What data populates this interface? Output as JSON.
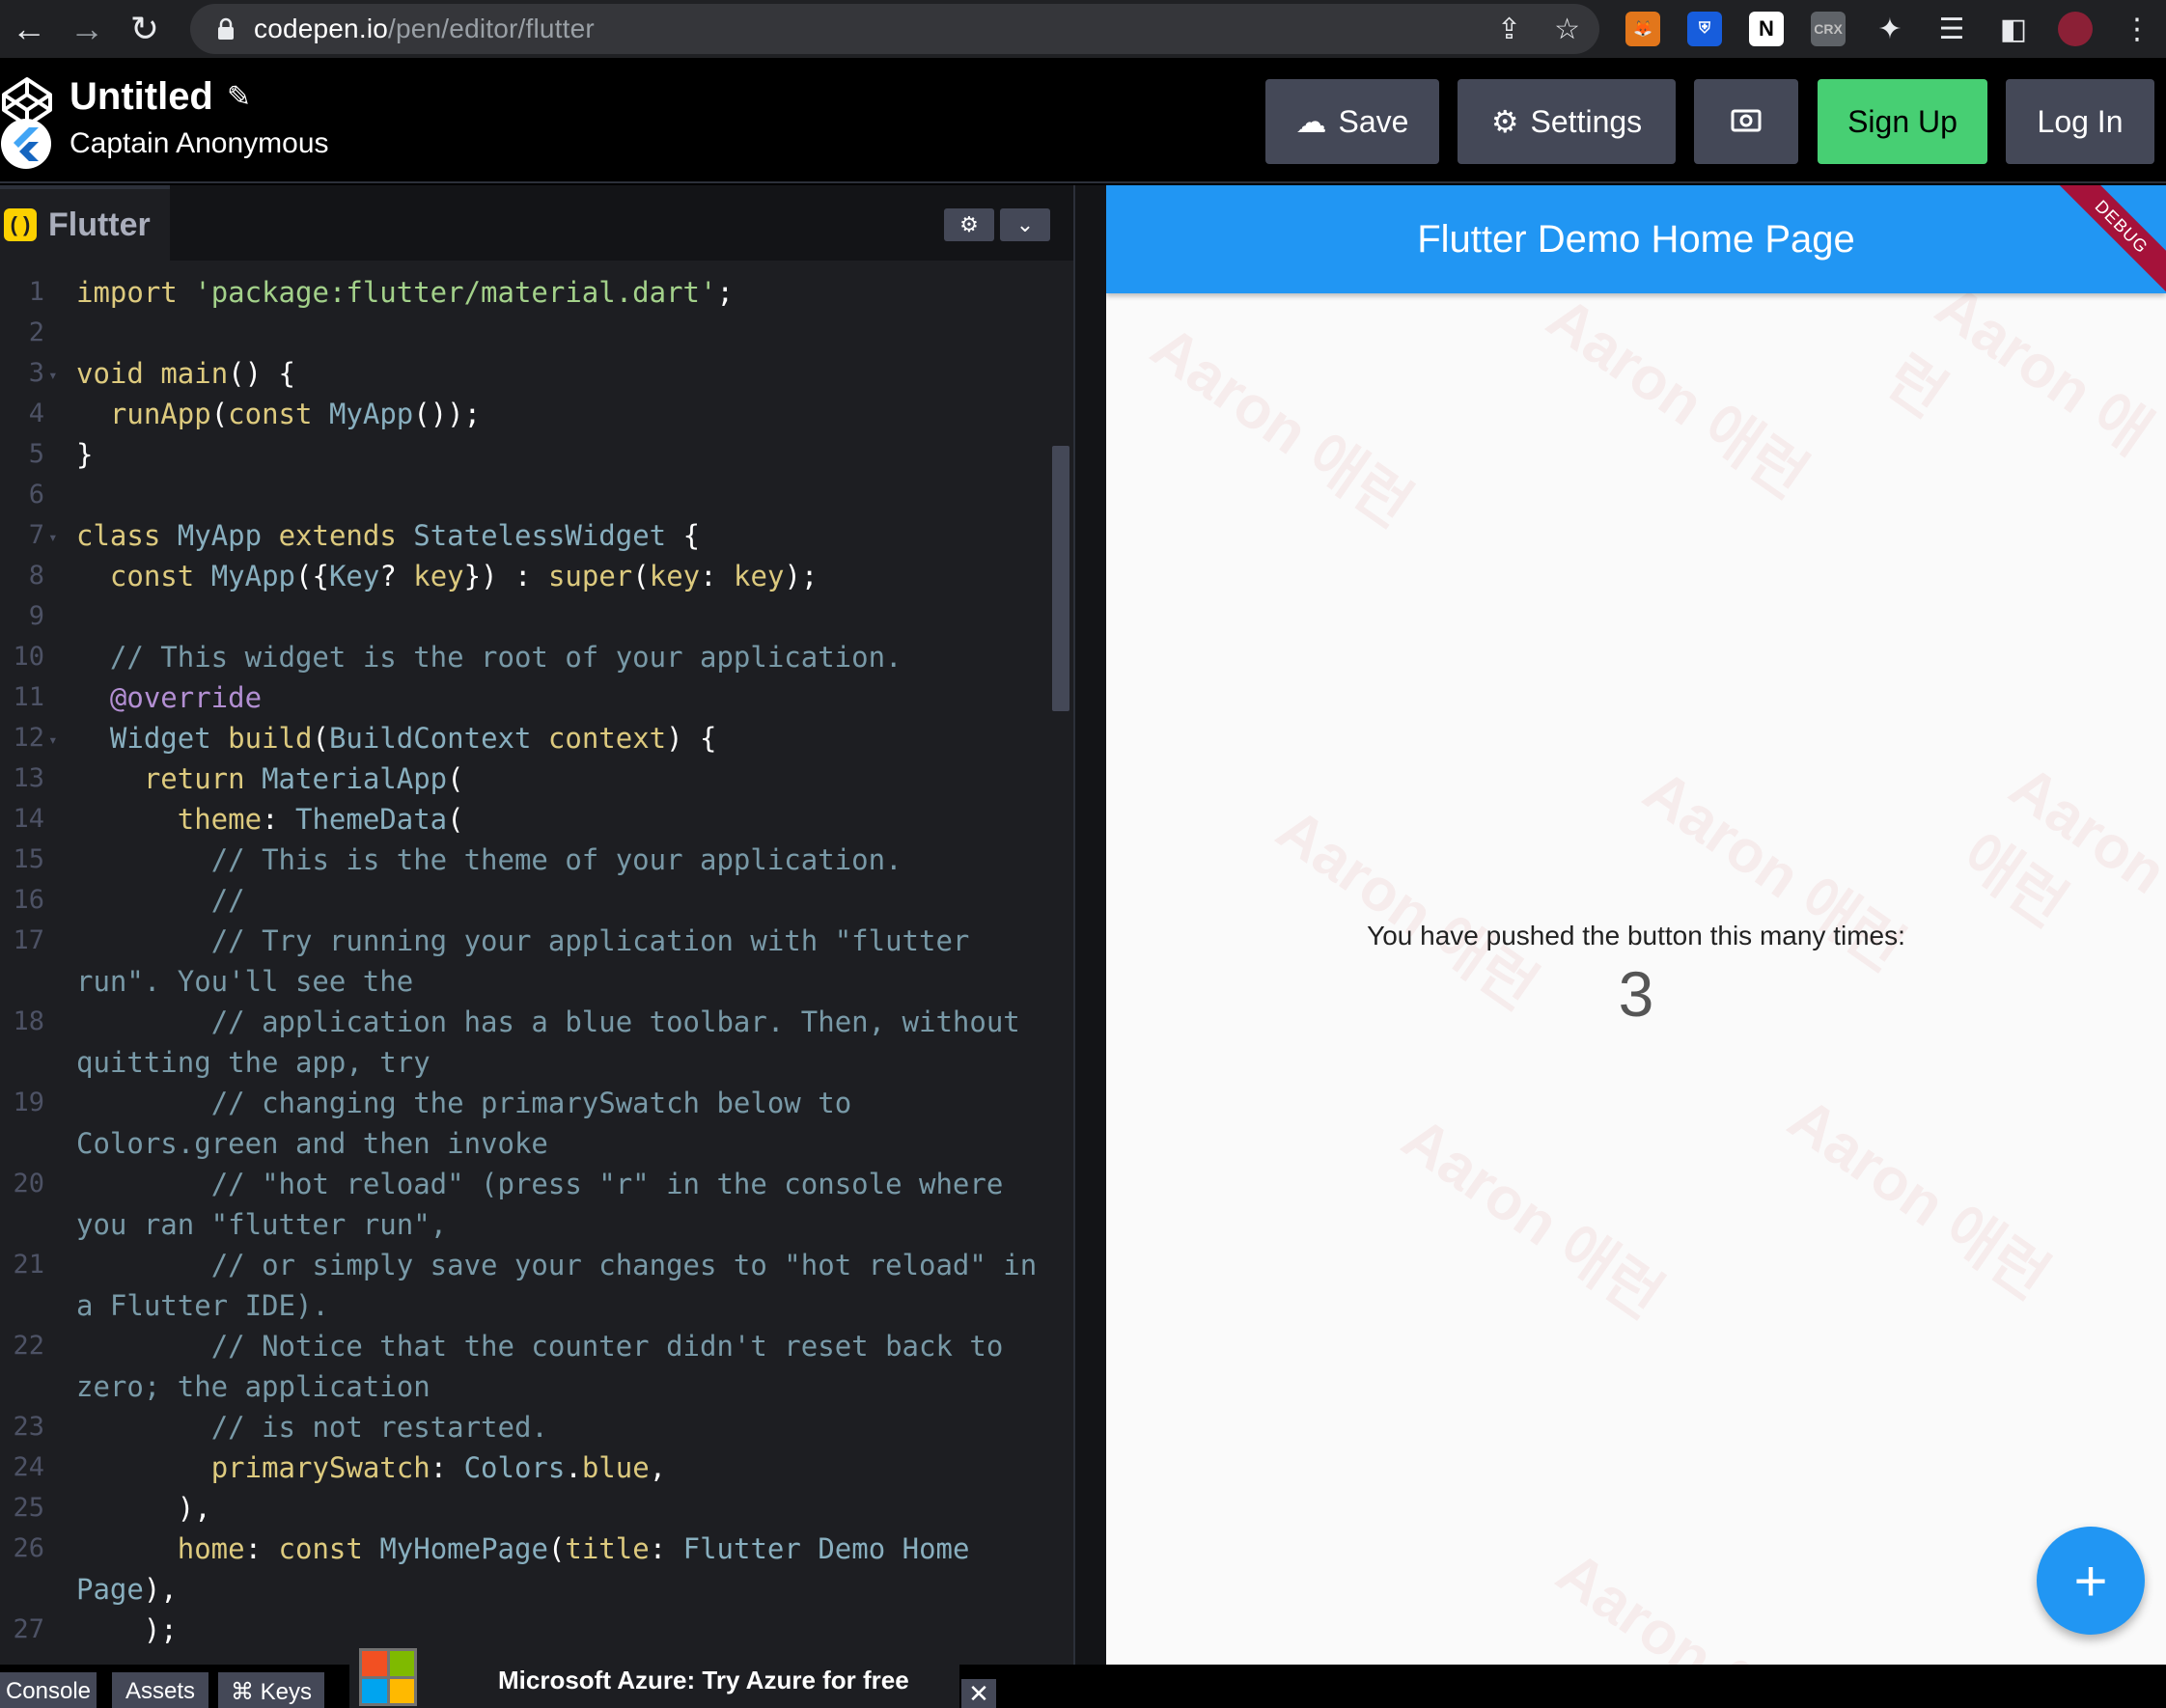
{
  "browser": {
    "url_host": "codepen.io",
    "url_path": "/pen/editor/flutter",
    "extension_label": "CRX"
  },
  "header": {
    "title": "Untitled",
    "author": "Captain Anonymous",
    "save_label": "Save",
    "settings_label": "Settings",
    "signup_label": "Sign Up",
    "login_label": "Log In"
  },
  "editor": {
    "tab_label": "Flutter",
    "lines": [
      {
        "n": "1",
        "t": "import 'package:flutter/material.dart';"
      },
      {
        "n": "2",
        "t": ""
      },
      {
        "n": "3",
        "t": "void main() {"
      },
      {
        "n": "4",
        "t": "  runApp(const MyApp());"
      },
      {
        "n": "5",
        "t": "}"
      },
      {
        "n": "6",
        "t": ""
      },
      {
        "n": "7",
        "t": "class MyApp extends StatelessWidget {"
      },
      {
        "n": "8",
        "t": "  const MyApp({Key? key}) : super(key: key);"
      },
      {
        "n": "9",
        "t": ""
      },
      {
        "n": "10",
        "t": "  // This widget is the root of your application."
      },
      {
        "n": "11",
        "t": "  @override"
      },
      {
        "n": "12",
        "t": "  Widget build(BuildContext context) {"
      },
      {
        "n": "13",
        "t": "    return MaterialApp("
      },
      {
        "n": "14",
        "t": "      theme: ThemeData("
      },
      {
        "n": "15",
        "t": "        // This is the theme of your application."
      },
      {
        "n": "16",
        "t": "        //"
      },
      {
        "n": "17",
        "t": "        // Try running your application with \"flutter"
      },
      {
        "n": "",
        "t": "run\". You'll see the"
      },
      {
        "n": "18",
        "t": "        // application has a blue toolbar. Then, without"
      },
      {
        "n": "",
        "t": "quitting the app, try"
      },
      {
        "n": "19",
        "t": "        // changing the primarySwatch below to"
      },
      {
        "n": "",
        "t": "Colors.green and then invoke"
      },
      {
        "n": "20",
        "t": "        // \"hot reload\" (press \"r\" in the console where"
      },
      {
        "n": "",
        "t": "you ran \"flutter run\","
      },
      {
        "n": "21",
        "t": "        // or simply save your changes to \"hot reload\" in"
      },
      {
        "n": "",
        "t": "a Flutter IDE)."
      },
      {
        "n": "22",
        "t": "        // Notice that the counter didn't reset back to"
      },
      {
        "n": "",
        "t": "zero; the application"
      },
      {
        "n": "23",
        "t": "        // is not restarted."
      },
      {
        "n": "24",
        "t": "        primarySwatch: Colors.blue,"
      },
      {
        "n": "25",
        "t": "      ),"
      },
      {
        "n": "26",
        "t": "      home: const MyHomePage(title: 'Flutter Demo Home"
      },
      {
        "n": "",
        "t": "Page'),"
      },
      {
        "n": "27",
        "t": "    );"
      }
    ]
  },
  "preview": {
    "app_title": "Flutter Demo Home Page",
    "debug_banner": "DEBUG",
    "counter_label": "You have pushed the button this many times:",
    "counter_value": "3",
    "fab_symbol": "+",
    "watermark": "Aaron 애런"
  },
  "bottom": {
    "console_label": "Console",
    "assets_label": "Assets",
    "keys_label": "⌘ Keys",
    "ad_text": "Microsoft Azure: Try Azure for free",
    "ad_close": "✕"
  },
  "colors": {
    "primary": "#2196f3",
    "signup": "#47cf73",
    "button": "#444857",
    "editor_bg": "#1d1e22"
  }
}
